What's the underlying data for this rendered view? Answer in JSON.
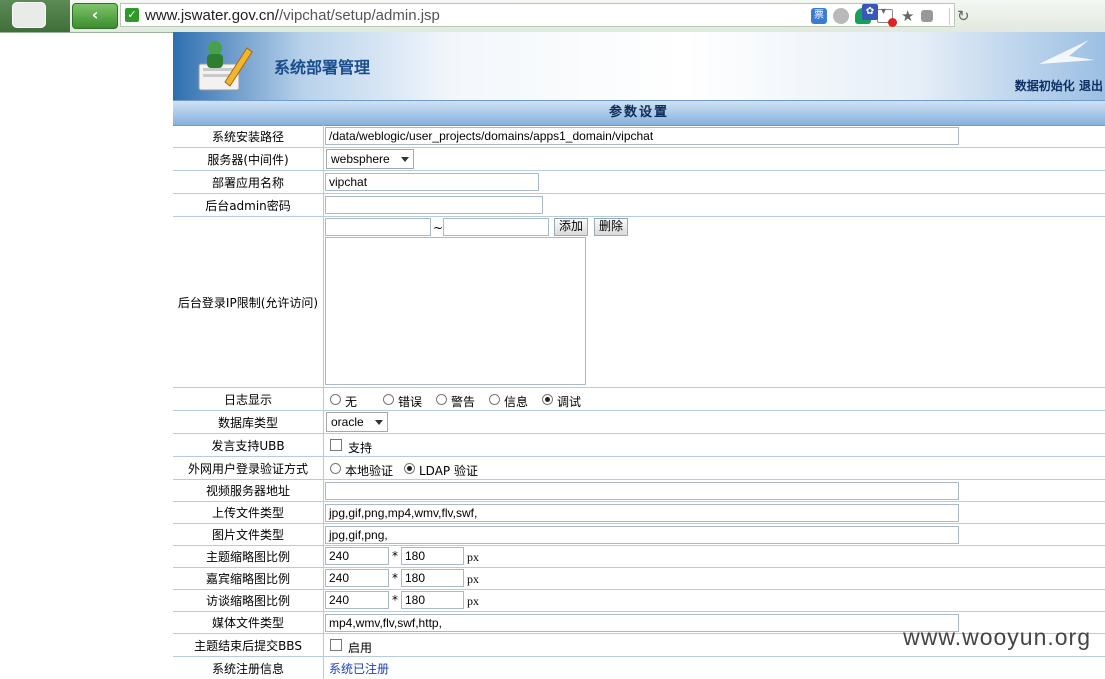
{
  "browser": {
    "url_host": "www.jswater.gov.cn/",
    "url_path": "/vipchat/setup/admin.jsp",
    "back_icon": "chevron-left-icon",
    "ext_badge": "票"
  },
  "header": {
    "title": "系统部署管理",
    "link_init": "数据初始化",
    "link_logout": "退出"
  },
  "section": {
    "title": "参数设置"
  },
  "form": {
    "install_path": {
      "label": "系统安装路径",
      "value": "/data/weblogic/user_projects/domains/apps1_domain/vipchat"
    },
    "server": {
      "label": "服务器(中间件)",
      "value": "websphere"
    },
    "app_name": {
      "label": "部署应用名称",
      "value": "vipchat"
    },
    "admin_pwd": {
      "label": "后台admin密码",
      "value": ""
    },
    "ip_limit": {
      "label": "后台登录IP限制(允许访问)",
      "sep": "~",
      "add": "添加",
      "delete": "删除"
    },
    "log": {
      "label": "日志显示",
      "options": [
        "无",
        "错误",
        "警告",
        "信息",
        "调试"
      ],
      "selected": "调试"
    },
    "db_type": {
      "label": "数据库类型",
      "value": "oracle"
    },
    "ubb": {
      "label": "发言支持UBB",
      "option": "支持",
      "checked": false
    },
    "ext_login": {
      "label": "外网用户登录验证方式",
      "options": [
        "本地验证",
        "LDAP 验证"
      ],
      "selected": "LDAP 验证"
    },
    "video_server": {
      "label": "视频服务器地址",
      "value": ""
    },
    "upload_types": {
      "label": "上传文件类型",
      "value": "jpg,gif,png,mp4,wmv,flv,swf,"
    },
    "image_types": {
      "label": "图片文件类型",
      "value": "jpg,gif,png,"
    },
    "topic_thumb": {
      "label": "主题缩略图比例",
      "w": "240",
      "h": "180",
      "times": "*",
      "unit": "px"
    },
    "guest_thumb": {
      "label": "嘉宾缩略图比例",
      "w": "240",
      "h": "180",
      "times": "*",
      "unit": "px"
    },
    "interview_thumb": {
      "label": "访谈缩略图比例",
      "w": "240",
      "h": "180",
      "times": "*",
      "unit": "px"
    },
    "media_types": {
      "label": "媒体文件类型",
      "value": "mp4,wmv,flv,swf,http,"
    },
    "bbs": {
      "label": "主题结束后提交BBS",
      "option": "启用",
      "checked": false
    },
    "reg_info": {
      "label": "系统注册信息",
      "value": "系统已注册"
    }
  },
  "watermark": "www.wooyun.org"
}
